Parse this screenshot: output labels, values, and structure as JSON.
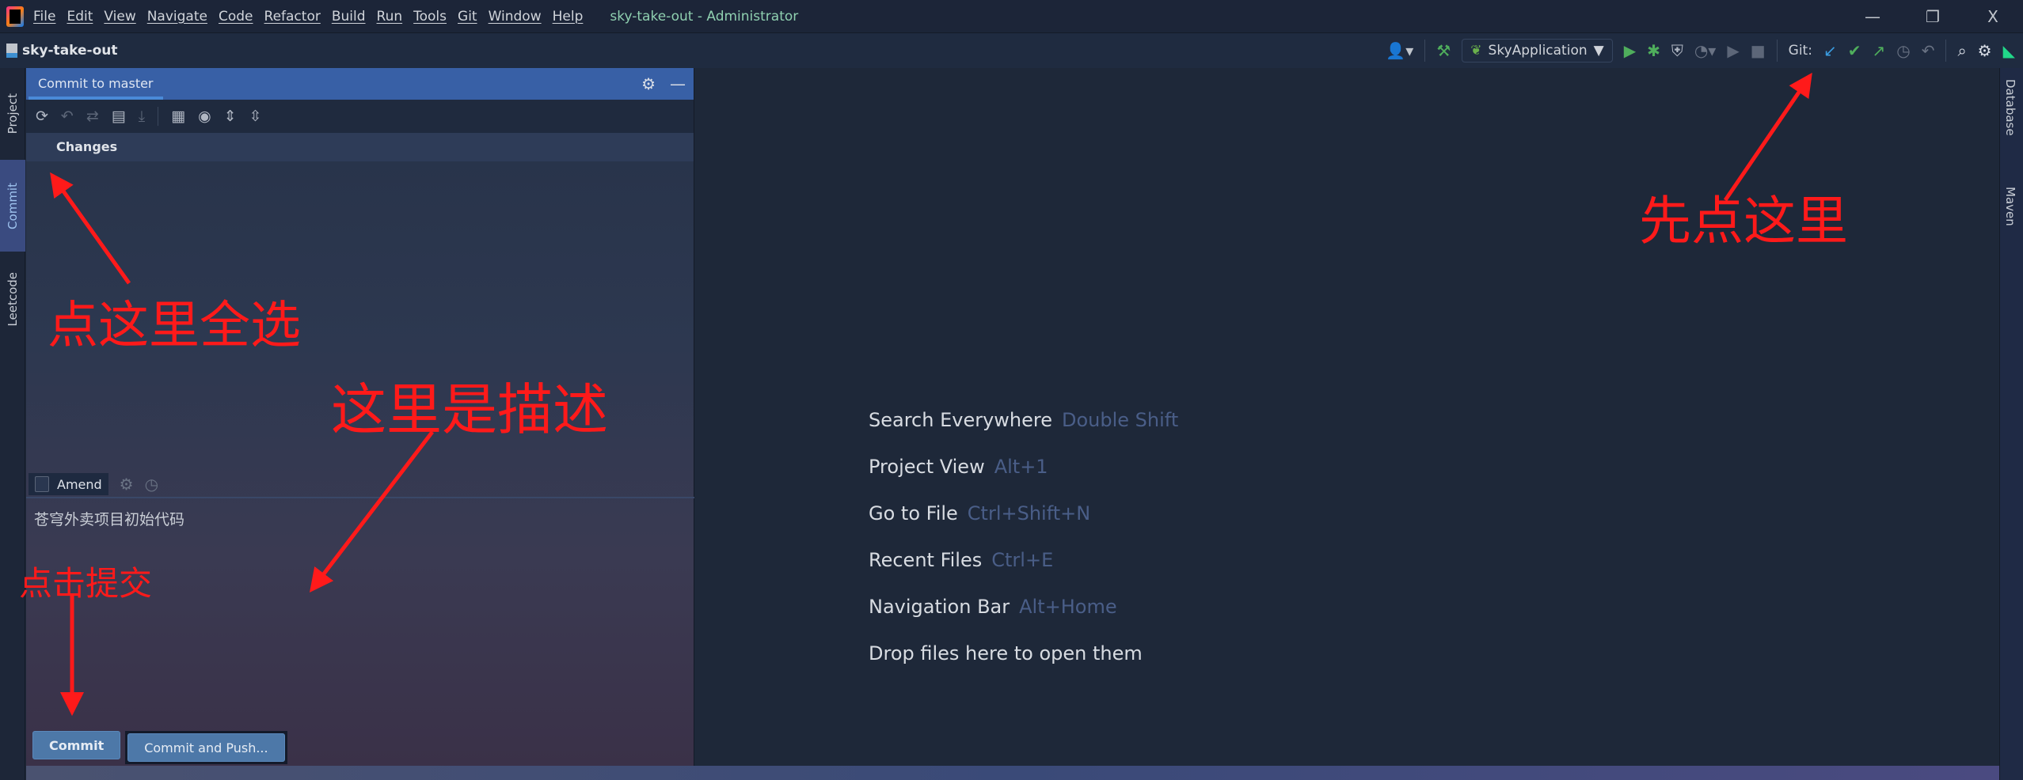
{
  "titlebar": {
    "menu": [
      "File",
      "Edit",
      "View",
      "Navigate",
      "Code",
      "Refactor",
      "Build",
      "Run",
      "Tools",
      "Git",
      "Window",
      "Help"
    ],
    "title": "sky-take-out - Administrator",
    "controls": {
      "minimize": "—",
      "restore": "❐",
      "close": "X"
    }
  },
  "navbar": {
    "project": "sky-take-out",
    "run_config": "SkyApplication",
    "git_label": "Git:"
  },
  "left_stripe": {
    "tabs": [
      "Project",
      "Commit",
      "Leetcode"
    ]
  },
  "right_stripe": {
    "tabs": [
      "Database",
      "Maven"
    ]
  },
  "commit_panel": {
    "tab": "Commit to master",
    "changes_header": "Changes",
    "amend_label": "Amend",
    "message": "苍穹外卖项目初始代码",
    "commit_button": "Commit",
    "commit_push_button": "Commit and Push..."
  },
  "editor_hints": [
    {
      "label": "Search Everywhere",
      "key": "Double Shift"
    },
    {
      "label": "Project View",
      "key": "Alt+1"
    },
    {
      "label": "Go to File",
      "key": "Ctrl+Shift+N"
    },
    {
      "label": "Recent Files",
      "key": "Ctrl+E"
    },
    {
      "label": "Navigation Bar",
      "key": "Alt+Home"
    },
    {
      "label": "Drop files here to open them",
      "key": ""
    }
  ],
  "annotations": {
    "select_all": "点这里全选",
    "description": "这里是描述",
    "click_commit": "点击提交",
    "click_here_first": "先点这里",
    "color": "#ff1a1a"
  }
}
